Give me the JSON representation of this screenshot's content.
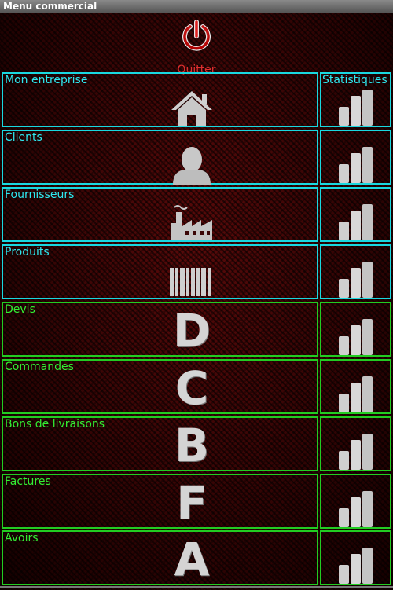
{
  "window": {
    "title": "Menu commercial"
  },
  "quit": {
    "label": "Quitter"
  },
  "stats_header": "Statistiques",
  "rows": [
    {
      "label": "Mon entreprise",
      "icon": "house-icon"
    },
    {
      "label": "Clients",
      "icon": "person-icon"
    },
    {
      "label": "Fournisseurs",
      "icon": "factory-icon"
    },
    {
      "label": "Produits",
      "icon": "barcode-icon"
    },
    {
      "label": "Devis",
      "letter": "D"
    },
    {
      "label": "Commandes",
      "letter": "C"
    },
    {
      "label": "Bons de livraisons",
      "letter": "B"
    },
    {
      "label": "Factures",
      "letter": "F"
    },
    {
      "label": "Avoirs",
      "letter": "A"
    }
  ],
  "colors": {
    "cyan_border": "#19d8e0",
    "green_border": "#22cc22",
    "quit_red": "#e03030"
  }
}
